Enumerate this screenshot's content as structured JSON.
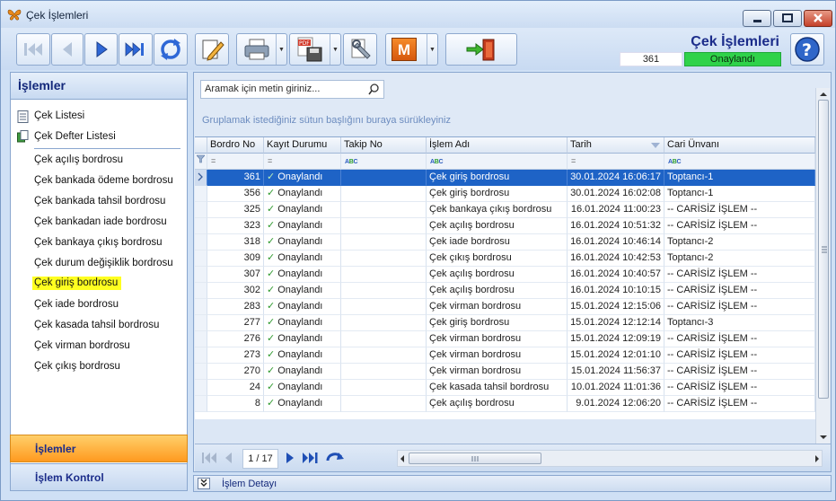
{
  "window": {
    "title": "Çek İşlemleri"
  },
  "header": {
    "title": "Çek İşlemleri",
    "count": "361",
    "status": "Onaylandı",
    "status_color": "#2fd24a"
  },
  "toolbar": {
    "buttons": [
      "first-record",
      "previous-record",
      "next-record",
      "last-record",
      "refresh",
      "edit",
      "print",
      "pdf-export",
      "tools",
      "m-action",
      "exit"
    ],
    "m_label": "M"
  },
  "sidebar": {
    "title": "İşlemler",
    "top_items": [
      "Çek Listesi",
      "Çek Defter Listesi"
    ],
    "items": [
      "Çek açılış bordrosu",
      "Çek bankada ödeme bordrosu",
      "Çek bankada tahsil bordrosu",
      "Çek bankadan iade bordrosu",
      "Çek bankaya çıkış bordrosu",
      "Çek durum değişiklik bordrosu",
      "Çek giriş bordrosu",
      "Çek iade bordrosu",
      "Çek kasada tahsil bordrosu",
      "Çek virman bordrosu",
      "Çek çıkış bordrosu"
    ],
    "selected_index": 6,
    "selected_color": "#ffff20",
    "nav_active": "İşlemler",
    "nav_other": "İşlem Kontrol"
  },
  "main": {
    "search_placeholder": "Aramak için metin giriniz...",
    "group_hint": "Gruplamak istediğiniz sütun başlığını buraya sürükleyiniz",
    "columns": [
      "Bordro No",
      "Kayıt Durumu",
      "Takip No",
      "İşlem Adı",
      "Tarih",
      "Cari Ünvanı"
    ],
    "filter_eq": "=",
    "rows": [
      [
        "361",
        "Onaylandı",
        "",
        "Çek giriş bordrosu",
        "30.01.2024 16:06:17",
        "Toptancı-1"
      ],
      [
        "356",
        "Onaylandı",
        "",
        "Çek giriş bordrosu",
        "30.01.2024 16:02:08",
        "Toptancı-1"
      ],
      [
        "325",
        "Onaylandı",
        "",
        "Çek bankaya çıkış bordrosu",
        "16.01.2024 11:00:23",
        "-- CARİSİZ İŞLEM --"
      ],
      [
        "323",
        "Onaylandı",
        "",
        "Çek açılış bordrosu",
        "16.01.2024 10:51:32",
        "-- CARİSİZ İŞLEM --"
      ],
      [
        "318",
        "Onaylandı",
        "",
        "Çek iade bordrosu",
        "16.01.2024 10:46:14",
        "Toptancı-2"
      ],
      [
        "309",
        "Onaylandı",
        "",
        "Çek çıkış bordrosu",
        "16.01.2024 10:42:53",
        "Toptancı-2"
      ],
      [
        "307",
        "Onaylandı",
        "",
        "Çek açılış bordrosu",
        "16.01.2024 10:40:57",
        "-- CARİSİZ İŞLEM --"
      ],
      [
        "302",
        "Onaylandı",
        "",
        "Çek açılış bordrosu",
        "16.01.2024 10:10:15",
        "-- CARİSİZ İŞLEM --"
      ],
      [
        "283",
        "Onaylandı",
        "",
        "Çek virman bordrosu",
        "15.01.2024 12:15:06",
        "-- CARİSİZ İŞLEM --"
      ],
      [
        "277",
        "Onaylandı",
        "",
        "Çek giriş bordrosu",
        "15.01.2024 12:12:14",
        "Toptancı-3"
      ],
      [
        "276",
        "Onaylandı",
        "",
        "Çek virman bordrosu",
        "15.01.2024 12:09:19",
        "-- CARİSİZ İŞLEM --"
      ],
      [
        "273",
        "Onaylandı",
        "",
        "Çek virman bordrosu",
        "15.01.2024 12:01:10",
        "-- CARİSİZ İŞLEM --"
      ],
      [
        "270",
        "Onaylandı",
        "",
        "Çek virman bordrosu",
        "15.01.2024 11:56:37",
        "-- CARİSİZ İŞLEM --"
      ],
      [
        "24",
        "Onaylandı",
        "",
        "Çek kasada tahsil bordrosu",
        "10.01.2024 11:01:36",
        "-- CARİSİZ İŞLEM --"
      ],
      [
        "8",
        "Onaylandı",
        "",
        "Çek açılış bordrosu",
        "9.01.2024 12:06:20",
        "-- CARİSİZ İŞLEM --"
      ]
    ],
    "selected_row": 0,
    "pager": {
      "page": "1 / 17"
    }
  },
  "detail": {
    "label": "İşlem Detayı"
  }
}
